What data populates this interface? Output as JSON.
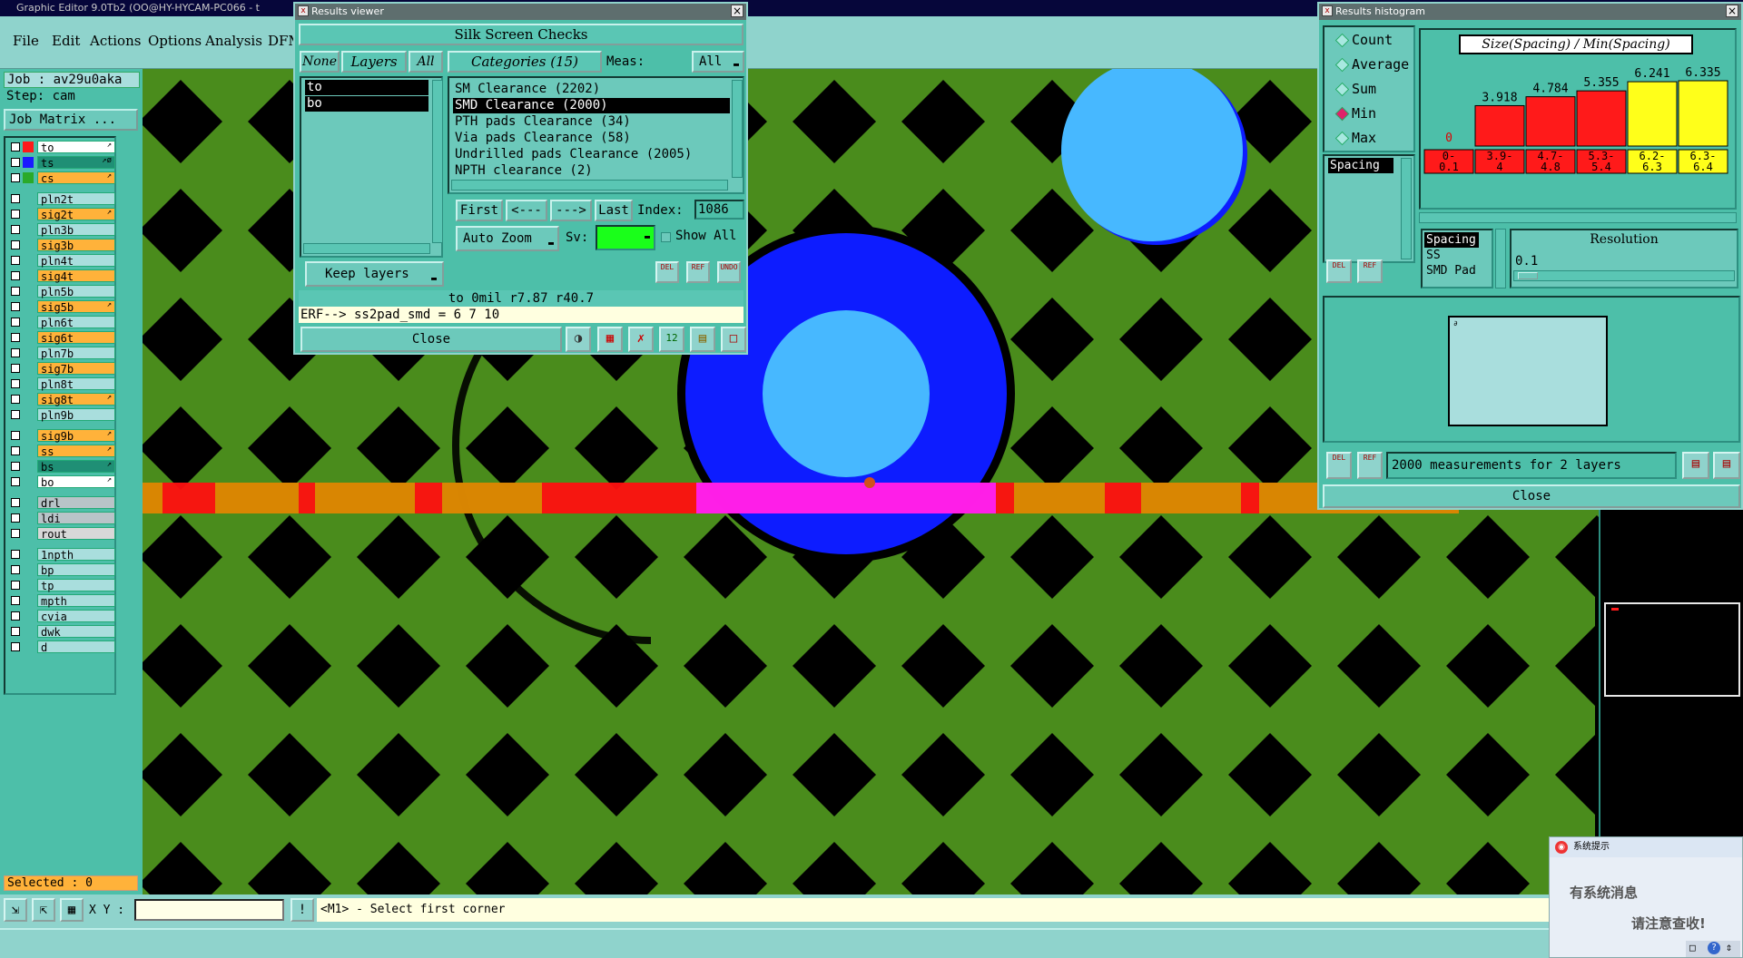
{
  "window": {
    "title": "Graphic Editor 9.0Tb2 (OO@HY-HYCAM-PC066 - t"
  },
  "menu": [
    "File",
    "Edit",
    "Actions",
    "Options",
    "Analysis",
    "DFM"
  ],
  "job": {
    "job_label": "Job : av29u0aka",
    "step_label": "Step: cam",
    "job_matrix_label": "Job Matrix ..."
  },
  "layers": [
    {
      "name": "to",
      "color": "#ffffff",
      "swatch": "#ff1a1a",
      "arrow": "↗"
    },
    {
      "name": "ts",
      "color": "#1f8f75",
      "swatch": "#1a1aff",
      "arrow": "↗ø"
    },
    {
      "name": "cs",
      "color": "#ffb23a",
      "swatch": "#2aaa2a",
      "arrow": "↗"
    },
    {
      "name": "pln2t",
      "color": "#a9dedd",
      "swatch": "",
      "arrow": ""
    },
    {
      "name": "sig2t",
      "color": "#ffb23a",
      "swatch": "",
      "arrow": "↗"
    },
    {
      "name": "pln3b",
      "color": "#a9dedd",
      "swatch": "",
      "arrow": ""
    },
    {
      "name": "sig3b",
      "color": "#ffb23a",
      "swatch": "",
      "arrow": ""
    },
    {
      "name": "pln4t",
      "color": "#a9dedd",
      "swatch": "",
      "arrow": ""
    },
    {
      "name": "sig4t",
      "color": "#ffb23a",
      "swatch": "",
      "arrow": ""
    },
    {
      "name": "pln5b",
      "color": "#a9dedd",
      "swatch": "",
      "arrow": ""
    },
    {
      "name": "sig5b",
      "color": "#ffb23a",
      "swatch": "",
      "arrow": "↗"
    },
    {
      "name": "pln6t",
      "color": "#a9dedd",
      "swatch": "",
      "arrow": ""
    },
    {
      "name": "sig6t",
      "color": "#ffb23a",
      "swatch": "",
      "arrow": ""
    },
    {
      "name": "pln7b",
      "color": "#a9dedd",
      "swatch": "",
      "arrow": ""
    },
    {
      "name": "sig7b",
      "color": "#ffb23a",
      "swatch": "",
      "arrow": ""
    },
    {
      "name": "pln8t",
      "color": "#a9dedd",
      "swatch": "",
      "arrow": ""
    },
    {
      "name": "sig8t",
      "color": "#ffb23a",
      "swatch": "",
      "arrow": "↗"
    },
    {
      "name": "pln9b",
      "color": "#a9dedd",
      "swatch": "",
      "arrow": ""
    },
    {
      "name": "sig9b",
      "color": "#ffb23a",
      "swatch": "",
      "arrow": "↗"
    },
    {
      "name": "ss",
      "color": "#ffb23a",
      "swatch": "",
      "arrow": "↗"
    },
    {
      "name": "bs",
      "color": "#1f8f75",
      "swatch": "",
      "arrow": "↗"
    },
    {
      "name": "bo",
      "color": "#ffffff",
      "swatch": "",
      "arrow": "↗"
    },
    {
      "name": "drl",
      "color": "#b8c4c8",
      "swatch": "",
      "arrow": ""
    },
    {
      "name": "ldi",
      "color": "#b8c4c8",
      "swatch": "",
      "arrow": ""
    },
    {
      "name": "rout",
      "color": "#d8d8d8",
      "swatch": "",
      "arrow": ""
    },
    {
      "name": "1npth",
      "color": "#a9dedd",
      "swatch": "",
      "arrow": ""
    },
    {
      "name": "bp",
      "color": "#a9dedd",
      "swatch": "",
      "arrow": ""
    },
    {
      "name": "tp",
      "color": "#a9dedd",
      "swatch": "",
      "arrow": ""
    },
    {
      "name": "mpth",
      "color": "#a9dedd",
      "swatch": "",
      "arrow": ""
    },
    {
      "name": "cvia",
      "color": "#a9dedd",
      "swatch": "",
      "arrow": ""
    },
    {
      "name": "dwk",
      "color": "#a9dedd",
      "swatch": "",
      "arrow": ""
    },
    {
      "name": "d",
      "color": "#a9dedd",
      "swatch": "",
      "arrow": ""
    }
  ],
  "status": {
    "selected": "Selected : 0",
    "xy_label": "X Y :",
    "xy_value": "",
    "prompt": "<M1> - Select first corner"
  },
  "results_viewer": {
    "title": "Results viewer",
    "header": "Silk Screen Checks",
    "none_label": "None",
    "layers_label": "Layers",
    "all_label": "All",
    "layer_items": [
      "to",
      "bo"
    ],
    "categories_label": "Categories (15)",
    "meas_label": "Meas:",
    "meas_value": "All",
    "categories": [
      "SM Clearance (2202)",
      "SMD Clearance (2000)",
      "PTH pads Clearance (34)",
      "Via pads Clearance (58)",
      "Undrilled pads Clearance (2005)",
      "NPTH clearance (2)"
    ],
    "selected_category": "SMD Clearance (2000)",
    "first": "First",
    "prev": "<---",
    "next": "--->",
    "last": "Last",
    "index_label": "Index:",
    "index_value": "1086",
    "auto_zoom": "Auto Zoom",
    "sv_label": "Sv:",
    "show_all": "Show All",
    "keep_layers": "Keep layers",
    "del": "DEL",
    "ref": "REF",
    "undo": "UNDO",
    "info_line": "to 0mil  r7.87  r40.7",
    "erf_line": "ERF--> ss2pad_smd = 6 7 10",
    "close": "Close"
  },
  "histogram": {
    "title": "Results histogram",
    "options": [
      "Count",
      "Average",
      "Sum",
      "Min",
      "Max"
    ],
    "selected_option": "Min",
    "measure_list": [
      "Spacing"
    ],
    "chart_title": "Size(Spacing) / Min(Spacing)",
    "resolution_label": "Resolution",
    "resolution_value": "0.1",
    "type_list": [
      "Spacing",
      "SS",
      "SMD Pad"
    ],
    "measurements": "2000 measurements for 2 layers",
    "close": "Close",
    "del": "DEL",
    "ref": "REF"
  },
  "chart_data": {
    "type": "bar",
    "title": "Size(Spacing) / Min(Spacing)",
    "categories": [
      "0-\n0.1",
      "3.9-\n4",
      "4.7-\n4.8",
      "5.3-\n5.4",
      "6.2-\n6.3",
      "6.3-\n6.4"
    ],
    "values": [
      0,
      3.918,
      4.784,
      5.355,
      6.241,
      6.335
    ],
    "value_labels": [
      "0",
      "3.918",
      "4.784",
      "5.355",
      "6.241",
      "6.335"
    ],
    "colors": [
      "#ff1a1a",
      "#ff1a1a",
      "#ff1a1a",
      "#ff1a1a",
      "#ffff1a",
      "#ffff1a"
    ]
  },
  "popup": {
    "title": "系统提示",
    "line1": "有系统消息",
    "line2": "请注意查收!"
  }
}
